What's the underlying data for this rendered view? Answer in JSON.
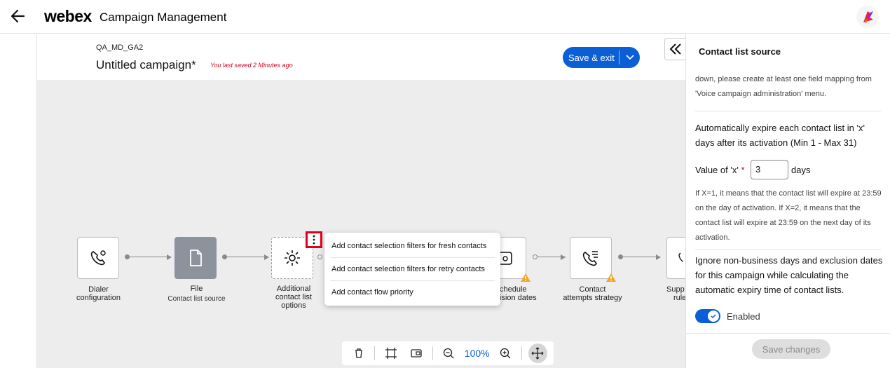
{
  "topbar": {
    "brand": "webex",
    "title": "Campaign Management"
  },
  "header": {
    "campaign_code": "QA_MD_GA2",
    "campaign_name": "Untitled campaign*",
    "saved_note": "You last saved 2 Minutes ago",
    "save_label": "Save & exit"
  },
  "nodes": [
    {
      "label": "Dialer configuration",
      "icon": "phone-gear-icon"
    },
    {
      "label": "File",
      "sub": "Contact list source",
      "icon": "file-icon"
    },
    {
      "label": "Additional contact list options",
      "icon": "gear-icon"
    },
    {
      "label": "chedule",
      "label2": "ision dates",
      "icon": "calendar-icon",
      "warning": true
    },
    {
      "label": "Contact",
      "label2": "attempts strategy",
      "icon": "phone-list-icon",
      "warning": true
    },
    {
      "label": "Supp",
      "label2": "rule",
      "icon": "phone-icon"
    }
  ],
  "menu": {
    "items": [
      "Add contact selection filters for fresh contacts",
      "Add contact selection filters for retry contacts",
      "Add contact flow priority"
    ]
  },
  "toolbar": {
    "zoom": "100%"
  },
  "panel": {
    "title": "Contact list source",
    "truncated_text": "down, please create at least one field mapping from 'Voice campaign administration' menu.",
    "expire_heading": "Automatically expire each contact list in 'x' days after its activation (Min 1 - Max 31)",
    "x_label": "Value of 'x'",
    "x_required": "*",
    "x_value": "3",
    "days_label": "days",
    "expire_note": "If X=1, it means that the contact list will expire at 23:59 on the day of activation. If X=2, it means that the contact list will expire at 23:59 on the next day of its activation.",
    "ignore_heading": "Ignore non-business days and exclusion dates for this campaign while calculating the automatic expiry time of contact lists.",
    "toggle_label": "Enabled",
    "toggle_on": true,
    "save_changes": "Save changes"
  }
}
